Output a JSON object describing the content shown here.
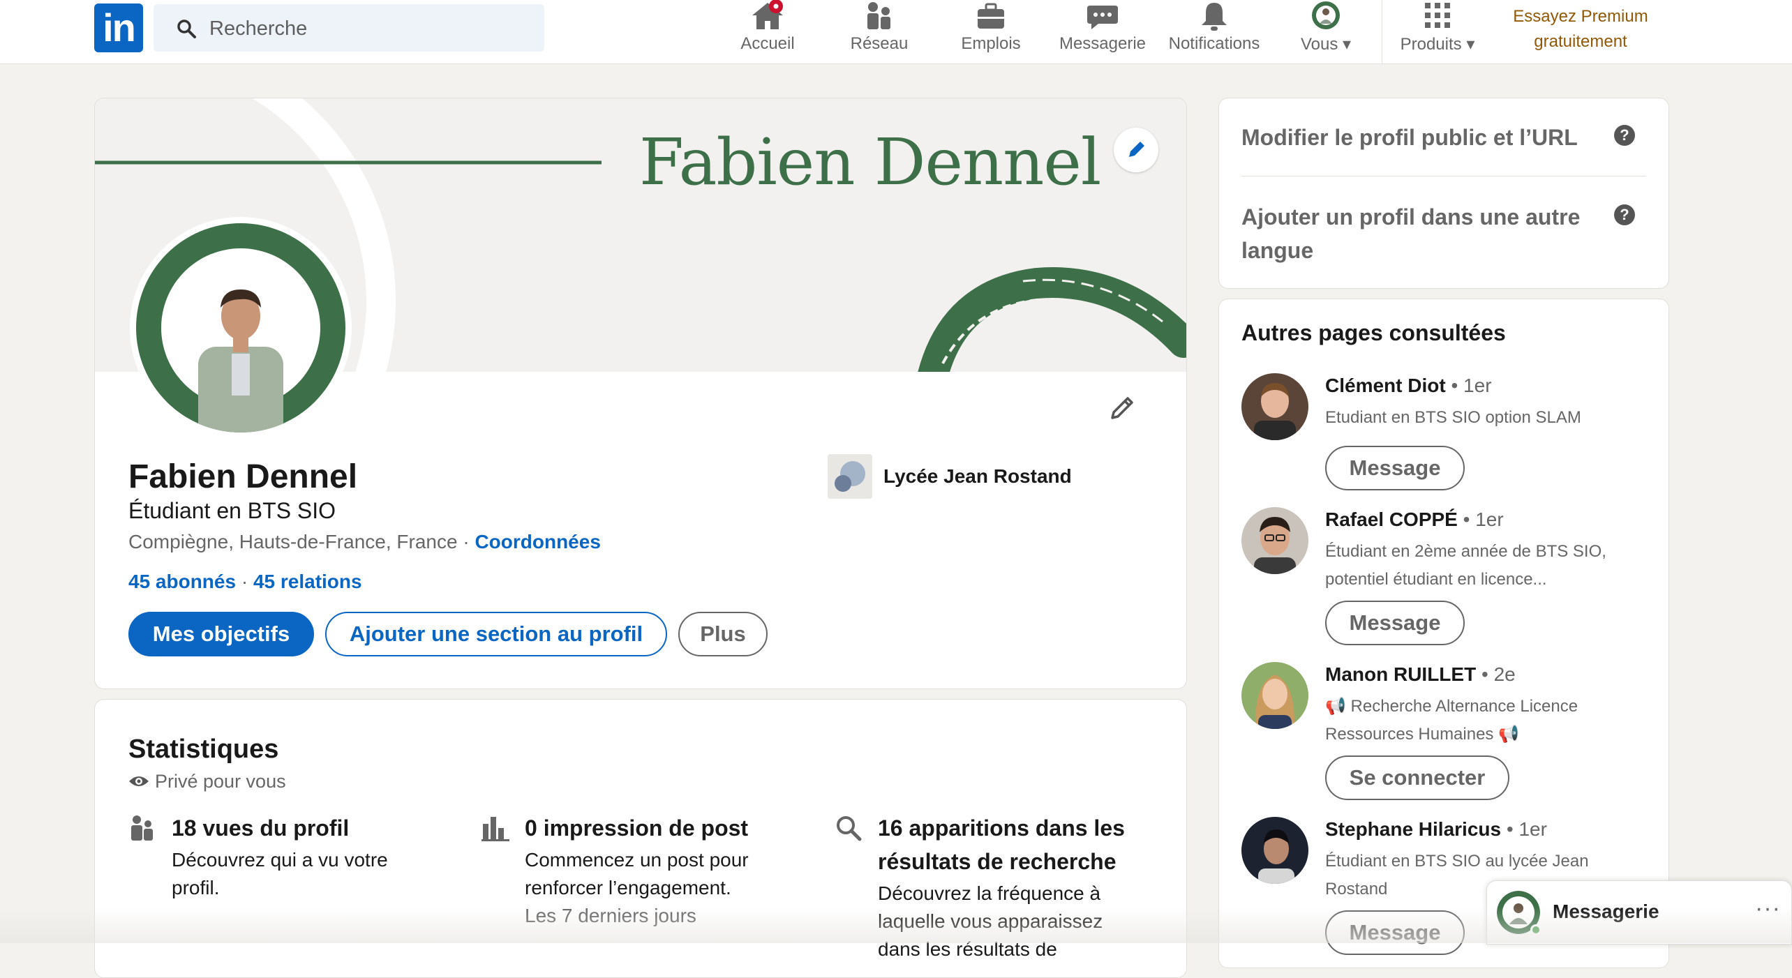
{
  "nav": {
    "logo_text": "in",
    "search_placeholder": "Recherche",
    "items": [
      {
        "label": "Accueil",
        "icon": "home-icon"
      },
      {
        "label": "Réseau",
        "icon": "network-icon"
      },
      {
        "label": "Emplois",
        "icon": "briefcase-icon"
      },
      {
        "label": "Messagerie",
        "icon": "chat-icon"
      },
      {
        "label": "Notifications",
        "icon": "bell-icon"
      },
      {
        "label": "Vous",
        "icon": "avatar-icon"
      },
      {
        "label": "Produits",
        "icon": "grid-icon"
      }
    ],
    "premium_line1": "Essayez Premium",
    "premium_line2": "gratuitement"
  },
  "profile": {
    "banner_name": "Fabien Dennel",
    "name": "Fabien Dennel",
    "headline": "Étudiant en BTS SIO",
    "location": "Compiègne, Hauts-de-France, France",
    "location_sep": " · ",
    "contact_link": "Coordonnées",
    "followers": "45 abonnés",
    "connections_sep": " · ",
    "connections": "45 relations",
    "school": "Lycée Jean Rostand",
    "buttons": {
      "goals": "Mes objectifs",
      "add_section": "Ajouter une section au profil",
      "more": "Plus"
    }
  },
  "stats": {
    "title": "Statistiques",
    "private": "Privé pour vous",
    "items": [
      {
        "title": "18 vues du profil",
        "desc1": "Découvrez qui a vu votre",
        "desc2": "profil."
      },
      {
        "title": "0 impression de post",
        "desc1": "Commencez un post pour",
        "desc2": "renforcer l’engagement.",
        "sub": "Les 7 derniers jours"
      },
      {
        "title1": "16 apparitions dans les",
        "title2": "résultats de recherche",
        "desc1": "Découvrez la fréquence à",
        "desc2": "laquelle vous apparaissez",
        "desc3": "dans les résultats de"
      }
    ]
  },
  "sidebar": {
    "public_profile": "Modifier le profil public et l’URL",
    "other_lang_1": "Ajouter un profil dans une autre",
    "other_lang_2": "langue",
    "help_glyph": "?"
  },
  "people": {
    "title": "Autres pages consultées",
    "list": [
      {
        "name": "Clément Diot",
        "degree": " • 1er",
        "desc1": "Etudiant en BTS SIO option SLAM",
        "desc2": "",
        "button": "Message"
      },
      {
        "name": "Rafael COPPÉ",
        "degree": " • 1er",
        "desc1": "Étudiant en 2ème année de BTS SIO,",
        "desc2": "potentiel étudiant en licence...",
        "button": "Message"
      },
      {
        "name": "Manon RUILLET",
        "degree": " • 2e",
        "desc1": "📢 Recherche Alternance Licence",
        "desc2": "Ressources Humaines 📢",
        "button": "Se connecter"
      },
      {
        "name": "Stephane Hilaricus",
        "degree": " • 1er",
        "desc1": "Étudiant en BTS SIO au lycée Jean",
        "desc2": "Rostand",
        "button": "Message"
      }
    ]
  },
  "messaging": {
    "title": "Messagerie",
    "more": "···"
  },
  "colors": {
    "brand": "#0a66c2",
    "banner_green": "#3d7048",
    "premium": "#915907",
    "notification_badge": "#cb112d"
  }
}
